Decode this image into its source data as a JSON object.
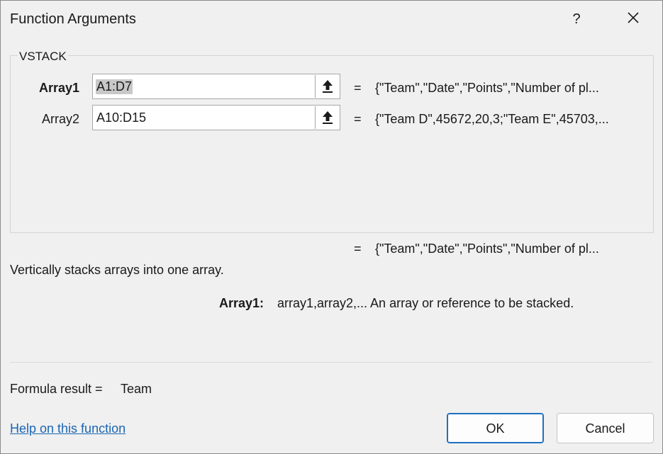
{
  "window": {
    "title": "Function Arguments",
    "help_glyph": "?",
    "close_glyph": "✕"
  },
  "function": {
    "name": "VSTACK",
    "arguments": [
      {
        "label": "Array1",
        "value": "A1:D7",
        "preview": "{\"Team\",\"Date\",\"Points\",\"Number of pl...",
        "active": true
      },
      {
        "label": "Array2",
        "value": "A10:D15",
        "preview": "{\"Team D\",45672,20,3;\"Team E\",45703,...",
        "active": false
      }
    ],
    "eq_sign": "=",
    "overall_preview": "{\"Team\",\"Date\",\"Points\",\"Number of pl...",
    "description": "Vertically stacks arrays into one array.",
    "arg_help_name": "Array1:",
    "arg_help_text": "array1,array2,... An array or reference to be stacked."
  },
  "result": {
    "label": "Formula result =",
    "value": "Team"
  },
  "footer": {
    "help_link": "Help on this function",
    "ok_label": "OK",
    "cancel_label": "Cancel"
  },
  "icons": {
    "ref_button": "upload-arrow-icon"
  },
  "colors": {
    "background": "#f0f0f0",
    "link": "#1a66b3",
    "ok_border": "#1f6fbf",
    "selection": "#c8c8c8"
  }
}
